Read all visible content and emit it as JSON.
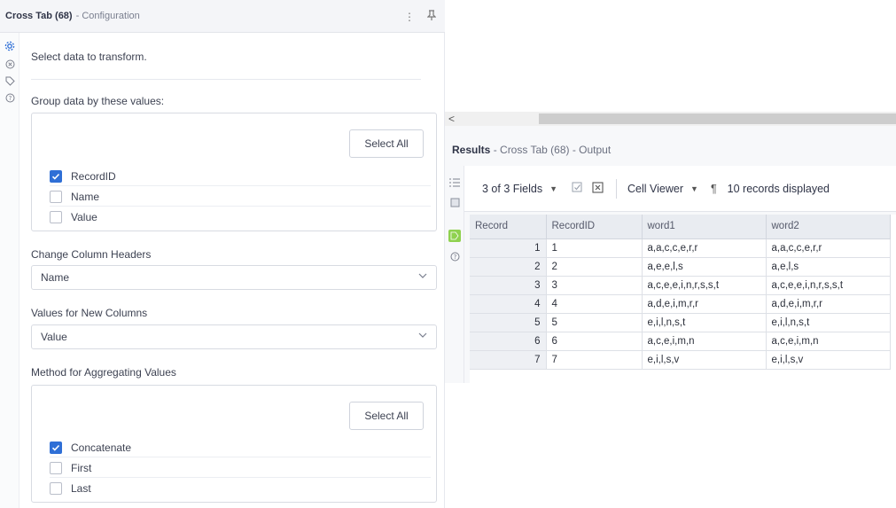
{
  "config": {
    "tool_name": "Cross Tab (68)",
    "subtitle": "- Configuration",
    "menu_icon": "more-vertical-icon",
    "pin_icon": "pin-icon",
    "rail_icons": [
      "gear-icon",
      "close-circle-icon",
      "tag-icon",
      "help-icon"
    ],
    "intro": "Select data to transform.",
    "group_label": "Group data by these values:",
    "group_select_all": "Select All",
    "group_items": [
      {
        "label": "RecordID",
        "checked": true
      },
      {
        "label": "Name",
        "checked": false
      },
      {
        "label": "Value",
        "checked": false
      }
    ],
    "headers_label": "Change Column Headers",
    "headers_value": "Name",
    "values_label": "Values for New Columns",
    "values_value": "Value",
    "method_label": "Method for Aggregating Values",
    "method_select_all": "Select All",
    "method_items": [
      {
        "label": "Concatenate",
        "checked": true
      },
      {
        "label": "First",
        "checked": false
      },
      {
        "label": "Last",
        "checked": false
      }
    ]
  },
  "results": {
    "scroll_left": "<",
    "title_bold": "Results",
    "title_rest": " - Cross Tab (68) - Output",
    "fields": "3 of 3 Fields",
    "cell_viewer": "Cell Viewer",
    "pilcrow": "¶",
    "records_displayed": "10 records displayed",
    "columns": [
      "Record",
      "RecordID",
      "word1",
      "word2"
    ],
    "rows": [
      [
        "1",
        "1",
        "a,a,c,c,e,r,r",
        "a,a,c,c,e,r,r"
      ],
      [
        "2",
        "2",
        "a,e,e,l,s",
        "a,e,l,s"
      ],
      [
        "3",
        "3",
        "a,c,e,e,i,n,r,s,s,t",
        "a,c,e,e,i,n,r,s,s,t"
      ],
      [
        "4",
        "4",
        "a,d,e,i,m,r,r",
        "a,d,e,i,m,r,r"
      ],
      [
        "5",
        "5",
        "e,i,l,n,s,t",
        "e,i,l,n,s,t"
      ],
      [
        "6",
        "6",
        "a,c,e,i,m,n",
        "a,c,e,i,m,n"
      ],
      [
        "7",
        "7",
        "e,i,l,s,v",
        "e,i,l,s,v"
      ]
    ]
  },
  "colors": {
    "accent": "#2f6fd6",
    "active_rail": "#8fd14f"
  }
}
